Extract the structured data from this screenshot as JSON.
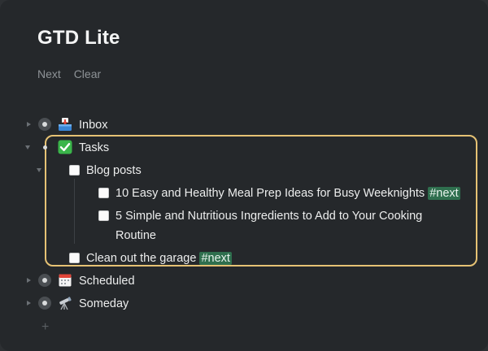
{
  "page": {
    "title": "GTD Lite"
  },
  "actions": {
    "next": "Next",
    "clear": "Clear"
  },
  "outline": {
    "inbox": {
      "label": "Inbox",
      "icon": "inbox-tray-icon"
    },
    "tasks": {
      "label": "Tasks",
      "icon": "check-mark-icon",
      "blog": {
        "label": "Blog posts",
        "item1": {
          "text": "10 Easy and Healthy Meal Prep Ideas for Busy Weeknights",
          "tag": "#next"
        },
        "item2": {
          "line1": "5 Simple and Nutritious Ingredients to Add to Your Cooking",
          "line2": "Routine"
        }
      },
      "garage": {
        "text": "Clean out the garage",
        "tag": "#next"
      }
    },
    "scheduled": {
      "label": "Scheduled",
      "icon": "calendar-icon"
    },
    "someday": {
      "label": "Someday",
      "icon": "telescope-icon"
    }
  },
  "add_symbol": "+",
  "colors": {
    "tag_bg": "#2f6f4e",
    "highlight_border": "#e6c274",
    "background": "#25282b"
  }
}
